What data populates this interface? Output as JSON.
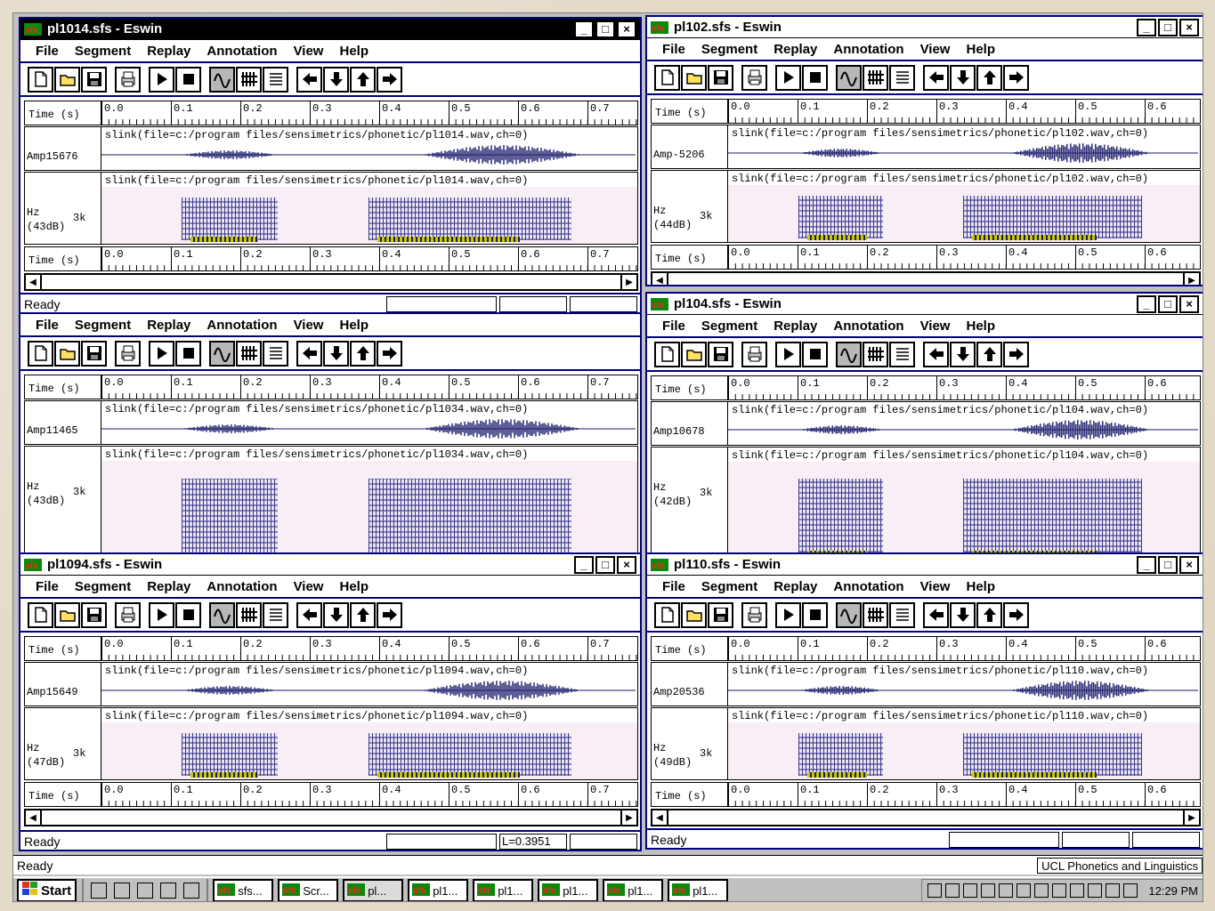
{
  "desktop": {
    "main_status": "Ready",
    "corp_status": "UCL Phonetics and Linguistics"
  },
  "menus": [
    "File",
    "Segment",
    "Replay",
    "Annotation",
    "View",
    "Help"
  ],
  "window_controls": [
    "_",
    "□",
    "×"
  ],
  "colors": {
    "title_active": "#000000",
    "menu_border": "#000080",
    "waveform": "#1a1a6a",
    "marker": "#c8c800",
    "spec_bg": "#f8eef6"
  },
  "tick_labels": [
    "0.0",
    "0.1",
    "0.2",
    "0.3",
    "0.4",
    "0.5",
    "0.6",
    "0.7"
  ],
  "windows": [
    {
      "title": "pl1014.sfs - Eswin",
      "time_label": "Time (s)",
      "amp_label": "Amp15676",
      "amp_caption": "slink(file=c:/program files/sensimetrics/phonetic/pl1014.wav,ch=0)",
      "spec_label1": "Hz",
      "spec_label2": "(43dB)",
      "spec_k": "3k",
      "spec_caption": "slink(file=c:/program files/sensimetrics/phonetic/pl1014.wav,ch=0)",
      "status": "Ready",
      "pane_value": ""
    },
    {
      "title": "pl102.sfs - Eswin",
      "time_label": "Time (s)",
      "amp_label": "Amp-5206",
      "amp_caption": "slink(file=c:/program files/sensimetrics/phonetic/pl102.wav,ch=0)",
      "spec_label1": "Hz",
      "spec_label2": "(44dB)",
      "spec_k": "3k",
      "spec_caption": "slink(file=c:/program files/sensimetrics/phonetic/pl102.wav,ch=0)",
      "status": "",
      "pane_value": ""
    },
    {
      "title": "",
      "time_label": "Time (s)",
      "amp_label": "Amp11465",
      "amp_caption": "slink(file=c:/program files/sensimetrics/phonetic/pl1034.wav,ch=0)",
      "spec_label1": "Hz",
      "spec_label2": "(43dB)",
      "spec_k": "3k",
      "spec_caption": "slink(file=c:/program files/sensimetrics/phonetic/pl1034.wav,ch=0)",
      "status": "",
      "pane_value": ""
    },
    {
      "title": "pl104.sfs - Eswin",
      "time_label": "Time (s)",
      "amp_label": "Amp10678",
      "amp_caption": "slink(file=c:/program files/sensimetrics/phonetic/pl104.wav,ch=0)",
      "spec_label1": "Hz",
      "spec_label2": "(42dB)",
      "spec_k": "3k",
      "spec_caption": "slink(file=c:/program files/sensimetrics/phonetic/pl104.wav,ch=0)",
      "status": "",
      "pane_value": ""
    },
    {
      "title": "pl1094.sfs - Eswin",
      "time_label": "Time (s)",
      "amp_label": "Amp15649",
      "amp_caption": "slink(file=c:/program files/sensimetrics/phonetic/pl1094.wav,ch=0)",
      "spec_label1": "Hz",
      "spec_label2": "(47dB)",
      "spec_k": "3k",
      "spec_caption": "slink(file=c:/program files/sensimetrics/phonetic/pl1094.wav,ch=0)",
      "status": "Ready",
      "pane_value": "L=0.3951"
    },
    {
      "title": "pl110.sfs - Eswin",
      "time_label": "Time (s)",
      "amp_label": "Amp20536",
      "amp_caption": "slink(file=c:/program files/sensimetrics/phonetic/pl110.wav,ch=0)",
      "spec_label1": "Hz",
      "spec_label2": "(49dB)",
      "spec_k": "3k",
      "spec_caption": "slink(file=c:/program files/sensimetrics/phonetic/pl110.wav,ch=0)",
      "status": "Ready",
      "pane_value": ""
    }
  ],
  "taskbar": {
    "start": "Start",
    "tasks": [
      "sfs...",
      "Scr...",
      "pl...",
      "pl1...",
      "pl1...",
      "pl1...",
      "pl1...",
      "pl1..."
    ],
    "clock": "12:29 PM"
  }
}
